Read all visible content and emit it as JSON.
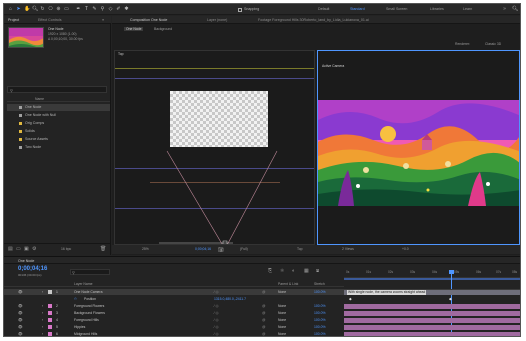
{
  "toolbar": {
    "snapping_label": "Snapping",
    "workspaces": [
      "Default",
      "Standard",
      "Small Screen",
      "Libraries",
      "Learn"
    ],
    "active_workspace": "Standard",
    "search_icon": "search-icon"
  },
  "project_panel": {
    "tab_project": "Project",
    "tab_effect_controls": "Effect Controls",
    "preview_name": "One Node",
    "preview_info_1": "1920 x 1080 (1.00)",
    "preview_info_2": "Δ 0;00;10;00, 30.00 fps",
    "column_name": "Name",
    "items": [
      {
        "name": "One Node",
        "color": "#a0a0a0",
        "type": "comp"
      },
      {
        "name": "One Node with Null",
        "color": "#a0a0a0",
        "type": "comp"
      },
      {
        "name": "Orig Comps",
        "color": "#e0b840",
        "type": "folder"
      },
      {
        "name": "Solids",
        "color": "#e0b840",
        "type": "folder"
      },
      {
        "name": "Source Assets",
        "color": "#e0b840",
        "type": "folder"
      },
      {
        "name": "Two Node",
        "color": "#a0a0a0",
        "type": "comp"
      }
    ],
    "bpc": "16 bpc"
  },
  "comp_panel": {
    "tab_comp": "Composition One Node",
    "tab_layer": "Layer (none)",
    "tab_footage": "Footage Foreground Hills 30Roberto_land_by_Lidia_Lukianova_01.ai",
    "breadcrumb_1": "One Node",
    "breadcrumb_2": "Background",
    "renderer_label": "Renderer:",
    "renderer_value": "Classic 3D",
    "left_view_label": "Top",
    "right_view_label": "Active Camera",
    "zoom": "25%",
    "timecode": "0;00;04;16",
    "resolution": "(Full)",
    "view_select": "Top",
    "views_count": "2 Views",
    "exposure": "+0.0"
  },
  "timeline": {
    "tab_name": "One Node",
    "timecode": "0;00;04;16",
    "frame_info": "00136 (30.00 fps)",
    "col_layer_name": "Layer Name",
    "col_parent": "Parent & Link",
    "col_stretch": "Stretch",
    "ruler_ticks": [
      "0s",
      "01s",
      "02s",
      "03s",
      "04s",
      "05s",
      "06s",
      "07s",
      "08s"
    ],
    "layers": [
      {
        "num": "1",
        "name": "One Node Camera",
        "color": "#c8c8c8",
        "parent": "None",
        "stretch": "100.0%",
        "bar": "#6e6e7a",
        "selected": true
      },
      {
        "num": "",
        "name": "Position",
        "color": "",
        "parent": "1315.0,480.0,-2411.7",
        "stretch": "",
        "bar": "",
        "selected": false
      },
      {
        "num": "2",
        "name": "Foreground Flowers",
        "color": "#d878c8",
        "parent": "None",
        "stretch": "100.0%",
        "bar": "#a06aa0",
        "selected": false
      },
      {
        "num": "3",
        "name": "Background Flowers",
        "color": "#d878c8",
        "parent": "None",
        "stretch": "100.0%",
        "bar": "#a06aa0",
        "selected": false
      },
      {
        "num": "4",
        "name": "Foreground Hills",
        "color": "#d878c8",
        "parent": "None",
        "stretch": "100.0%",
        "bar": "#a06aa0",
        "selected": false
      },
      {
        "num": "5",
        "name": "Hippies",
        "color": "#d878c8",
        "parent": "None",
        "stretch": "100.0%",
        "bar": "#a06aa0",
        "selected": false
      },
      {
        "num": "6",
        "name": "Midground Hills",
        "color": "#d878c8",
        "parent": "None",
        "stretch": "100.0%",
        "bar": "#a06aa0",
        "selected": false
      }
    ],
    "tooltip": "With single node, the camera zooms straight ahead"
  }
}
